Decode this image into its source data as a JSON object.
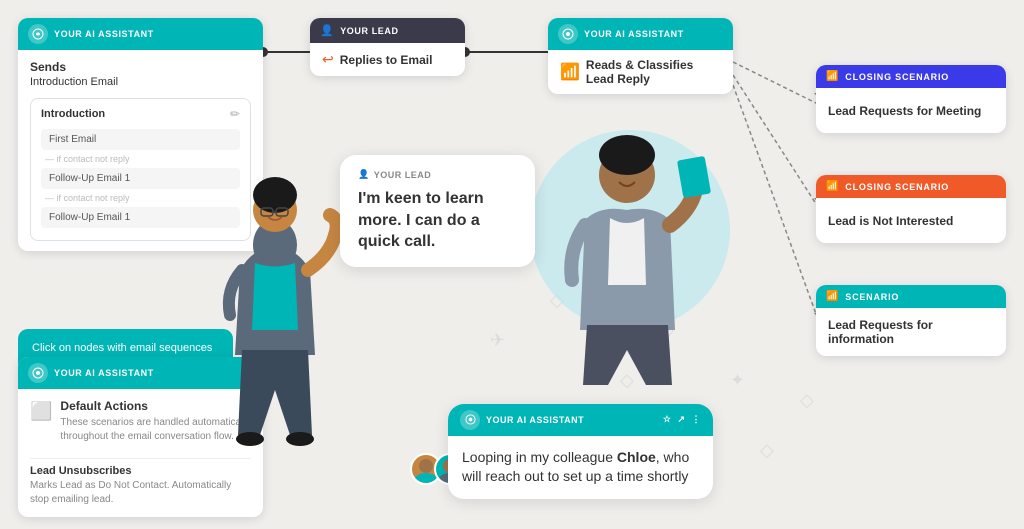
{
  "nodes": {
    "sends": {
      "header_label": "YOUR AI ASSISTANT",
      "title": "Sends",
      "subtitle": "Introduction Email",
      "intro_label": "Introduction",
      "emails": [
        {
          "label": "First Email"
        },
        {
          "label": "— If contact not reply"
        },
        {
          "label": "Follow-Up Email 1"
        },
        {
          "label": "— If contact not reply"
        },
        {
          "label": "Follow-Up Email 1"
        }
      ]
    },
    "lead": {
      "header_label": "YOUR LEAD",
      "action": "Replies to Email"
    },
    "reads": {
      "header_label": "YOUR AI ASSISTANT",
      "action1": "Reads & Classifies",
      "action2": "Lead Reply"
    },
    "closing1": {
      "tag": "CLOSING SCENARIO",
      "text": "Lead Requests for Meeting"
    },
    "closing2": {
      "tag": "CLOSING SCENARIO",
      "text": "Lead is Not Interested"
    },
    "closing3": {
      "tag": "SCENARIO",
      "text": "Lead Requests for information"
    },
    "hint": {
      "text": "Click on nodes with email sequences to customize your email messaging"
    },
    "default": {
      "header_label": "YOUR AI ASSISTANT",
      "title": "Default Actions",
      "desc": "These scenarios are handled automatically throughout the email conversation flow.",
      "unsub_title": "Lead Unsubscribes",
      "unsub_desc": "Marks Lead as Do Not Contact. Automatically stop emailing lead."
    },
    "speech": {
      "lead_label": "YOUR LEAD",
      "text": "I'm keen to learn more. I can do a quick call."
    },
    "ai_response": {
      "header_label": "YOUR AI ASSISTANT",
      "text_pre": "Looping in my colleague ",
      "name": "Chloe",
      "text_post": ", who will reach out to set up a time shortly"
    }
  }
}
